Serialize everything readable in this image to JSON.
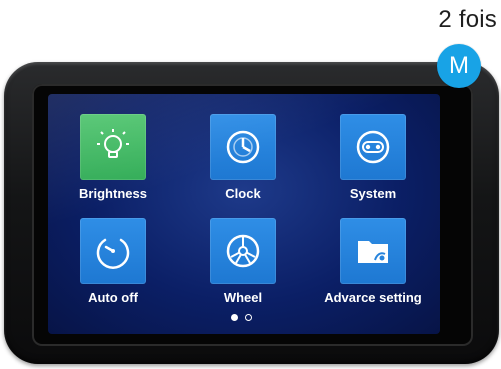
{
  "annotation": {
    "text": "2 fois",
    "badge": "M",
    "badge_color": "#18a3e6"
  },
  "menu": {
    "items": [
      {
        "label": "Brightness",
        "icon": "bulb-icon",
        "selected": true
      },
      {
        "label": "Clock",
        "icon": "clock-icon",
        "selected": false
      },
      {
        "label": "System",
        "icon": "system-icon",
        "selected": false
      },
      {
        "label": "Auto off",
        "icon": "power-timer-icon",
        "selected": false
      },
      {
        "label": "Wheel",
        "icon": "wheel-icon",
        "selected": false
      },
      {
        "label": "Advarce setting",
        "icon": "folder-settings-icon",
        "selected": false
      }
    ],
    "pagination": {
      "current_page": 1,
      "total_pages": 2
    }
  },
  "colors": {
    "selected_tile": "#3fb862",
    "tile": "#2784dc",
    "screen_bg": "#0b1f66"
  }
}
